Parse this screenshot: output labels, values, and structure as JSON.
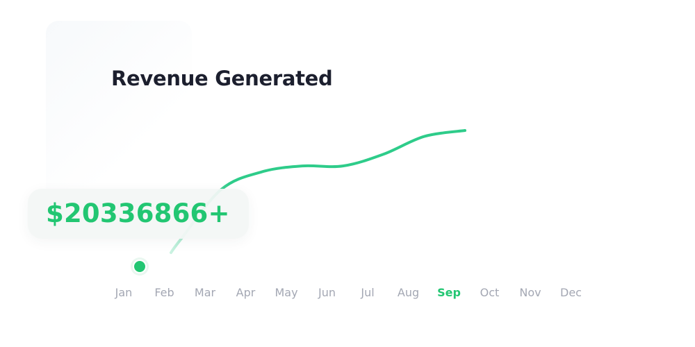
{
  "chart_data": {
    "type": "line",
    "title": "Revenue Generated",
    "categories": [
      "Jan",
      "Feb",
      "Mar",
      "Apr",
      "May",
      "Jun",
      "Jul",
      "Aug",
      "Sep",
      "Oct",
      "Nov",
      "Dec"
    ],
    "highlighted_category": "Sep",
    "series": [
      {
        "values": [
          0,
          18,
          52,
          64,
          68,
          68,
          76,
          88,
          92
        ]
      }
    ],
    "ylim": [
      0,
      100
    ],
    "grid": false,
    "legend": "none"
  },
  "badge": {
    "value": "$20336866+"
  },
  "colors": {
    "accent": "#22c672",
    "line": "#2ecc8a",
    "title": "#1c1f2e",
    "axis_label": "#a3a7b3"
  }
}
